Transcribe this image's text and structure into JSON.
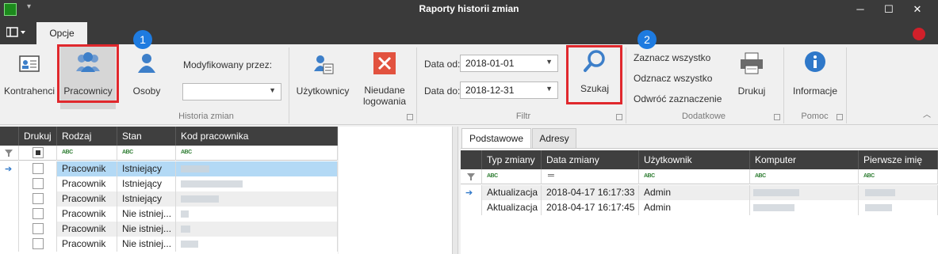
{
  "window": {
    "title": "Raporty historii zmian"
  },
  "ribbon": {
    "tab": "Opcje",
    "groups": {
      "historia": {
        "label": "Historia zmian",
        "kontrahenci": "Kontrahenci",
        "pracownicy": "Pracownicy",
        "osoby": "Osoby",
        "modyfikowany_label": "Modyfikowany przez:",
        "modyfikowany_value": "",
        "uzytkownicy": "Użytkownicy",
        "nieudane": [
          "Nieudane",
          "logowania"
        ]
      },
      "filtr": {
        "label": "Filtr",
        "data_od_label": "Data od:",
        "data_od": "2018-01-01",
        "data_do_label": "Data do:",
        "data_do": "2018-12-31",
        "szukaj": "Szukaj"
      },
      "dodatkowe": {
        "label": "Dodatkowe",
        "zaznacz": "Zaznacz wszystko",
        "odznacz": "Odznacz wszystko",
        "odwroc": "Odwróć zaznaczenie",
        "drukuj": "Drukuj"
      },
      "pomoc": {
        "label": "Pomoc",
        "informacje": "Informacje"
      }
    },
    "badges": [
      "1",
      "2"
    ],
    "icons": [
      "contact-card-icon",
      "people-group-icon",
      "person-icon",
      "user-list-icon",
      "red-x-icon",
      "magnifier-icon",
      "printer-icon",
      "info-icon"
    ]
  },
  "left_grid": {
    "headers": [
      "Drukuj",
      "Rodzaj",
      "Stan",
      "Kod pracownika"
    ],
    "rows": [
      {
        "rodzaj": "Pracownik",
        "stan": "Istniejący"
      },
      {
        "rodzaj": "Pracownik",
        "stan": "Istniejący"
      },
      {
        "rodzaj": "Pracownik",
        "stan": "Istniejący"
      },
      {
        "rodzaj": "Pracownik",
        "stan": "Nie istniej..."
      },
      {
        "rodzaj": "Pracownik",
        "stan": "Nie istniej..."
      },
      {
        "rodzaj": "Pracownik",
        "stan": "Nie istniej..."
      }
    ]
  },
  "right_panel": {
    "tabs": [
      "Podstawowe",
      "Adresy"
    ],
    "headers": [
      "Typ zmiany",
      "Data zmiany",
      "Użytkownik",
      "Komputer",
      "Pierwsze imię"
    ],
    "rows": [
      {
        "typ": "Aktualizacja",
        "data": "2018-04-17 16:17:33",
        "user": "Admin"
      },
      {
        "typ": "Aktualizacja",
        "data": "2018-04-17 16:17:45",
        "user": "Admin"
      }
    ]
  },
  "colors": {
    "accent_red": "#e0282d",
    "badge_blue": "#1e7be0",
    "header_dark": "#3f3f3f",
    "selected_row": "#b3d9f5"
  }
}
